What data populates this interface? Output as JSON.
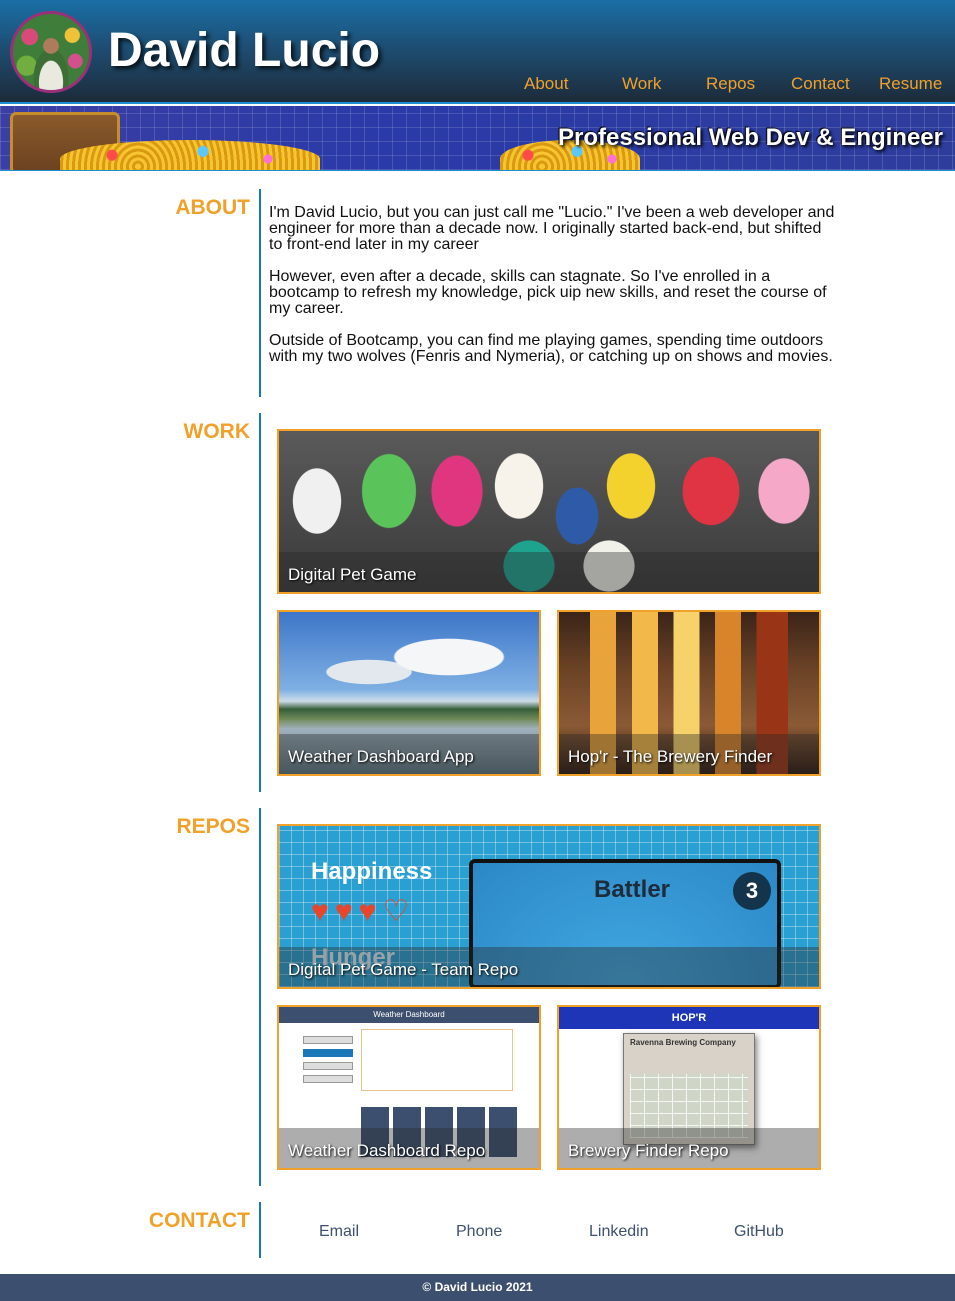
{
  "header": {
    "title": "David Lucio",
    "nav": [
      {
        "label": "About"
      },
      {
        "label": "Work"
      },
      {
        "label": "Repos"
      },
      {
        "label": "Contact"
      },
      {
        "label": "Resume"
      }
    ]
  },
  "banner": {
    "tagline": "Professional Web Dev & Engineer"
  },
  "about": {
    "heading": "ABOUT",
    "paragraphs": [
      "I'm David Lucio, but you can just call me \"Lucio.\" I've been a web developer and engineer for more than a decade now. I originally started back-end, but shifted to front-end later in my career",
      "However, even after a decade, skills can stagnate. So I've enrolled in a bootcamp to refresh my knowledge, pick uip new skills, and reset the course of my career.",
      "Outside of Bootcamp, you can find me playing games, spending time outdoors with my two wolves (Fenris and Nymeria), or catching up on shows and movies."
    ]
  },
  "work": {
    "heading": "WORK",
    "items": [
      {
        "title": "Digital Pet Game"
      },
      {
        "title": "Weather Dashboard App"
      },
      {
        "title": "Hop'r - The Brewery Finder"
      }
    ]
  },
  "repos": {
    "heading": "REPOS",
    "items": [
      {
        "title": "Digital Pet Game - Team Repo"
      },
      {
        "title": "Weather Dashboard Repo"
      },
      {
        "title": "Brewery Finder Repo"
      }
    ],
    "pet_thumb": {
      "happiness": "Happiness",
      "hunger": "Hunger",
      "battler": "Battler",
      "score": "3",
      "hearts": "♥♥♥♡"
    },
    "weather_thumb": {
      "bar": "Weather Dashboard"
    },
    "hopr_thumb": {
      "bar": "HOP'R",
      "brewery": "Ravenna Brewing Company"
    }
  },
  "contact": {
    "heading": "CONTACT",
    "links": [
      {
        "label": "Email"
      },
      {
        "label": "Phone"
      },
      {
        "label": "Linkedin"
      },
      {
        "label": "GitHub"
      }
    ]
  },
  "footer": {
    "text": "© David Lucio 2021"
  },
  "colors": {
    "accent": "#f0a12a",
    "line": "#1a78b8",
    "footer_bg": "#3d4f6e"
  }
}
